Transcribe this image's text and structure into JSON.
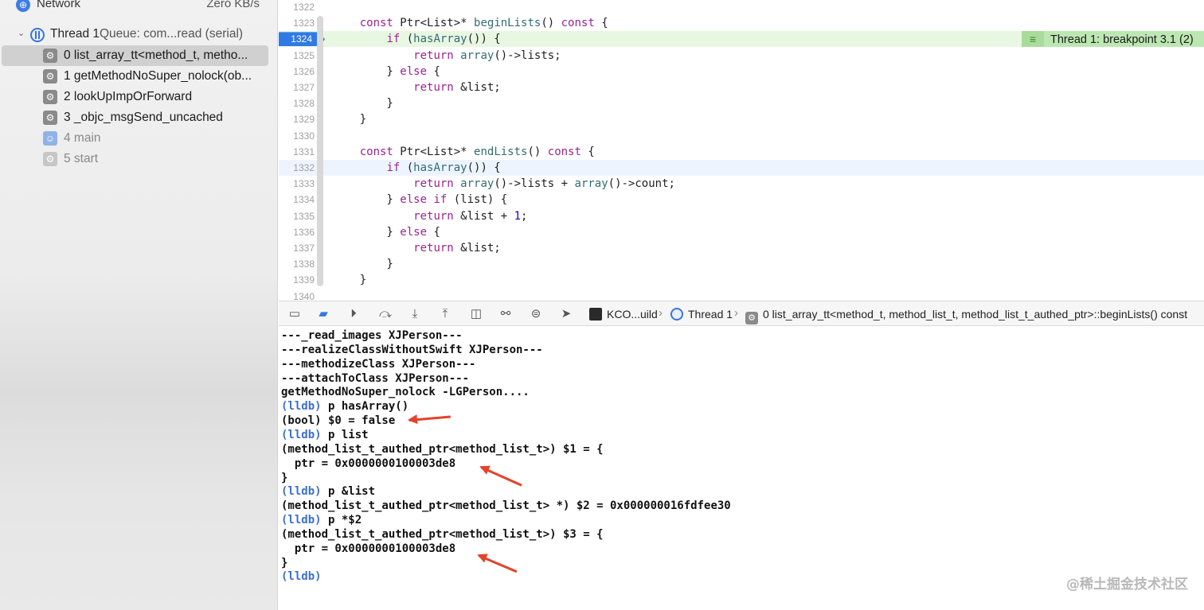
{
  "sidebar": {
    "network": {
      "icon": "network-globe-icon",
      "label": "Network",
      "value": "Zero KB/s"
    },
    "thread": {
      "name": "Thread 1",
      "queue": "Queue: com...read (serial)"
    },
    "frames": [
      {
        "label": "0 list_array_tt<method_t, metho...",
        "icon": "gear-icon",
        "selected": true
      },
      {
        "label": "1 getMethodNoSuper_nolock(ob...",
        "icon": "gear-icon"
      },
      {
        "label": "2 lookUpImpOrForward",
        "icon": "gear-icon"
      },
      {
        "label": "3 _objc_msgSend_uncached",
        "icon": "gear-icon"
      },
      {
        "label": "4 main",
        "icon": "user-icon"
      },
      {
        "label": "5 start",
        "icon": "gear-icon"
      }
    ]
  },
  "editor": {
    "lines": [
      {
        "num": "1322",
        "text": ""
      },
      {
        "num": "1323",
        "text": "    const Ptr<List>* beginLists() const {"
      },
      {
        "num": "1324",
        "text": "        if (hasArray()) {"
      },
      {
        "num": "1325",
        "text": "            return array()->lists;"
      },
      {
        "num": "1326",
        "text": "        } else {"
      },
      {
        "num": "1327",
        "text": "            return &list;"
      },
      {
        "num": "1328",
        "text": "        }"
      },
      {
        "num": "1329",
        "text": "    }"
      },
      {
        "num": "1330",
        "text": ""
      },
      {
        "num": "1331",
        "text": "    const Ptr<List>* endLists() const {"
      },
      {
        "num": "1332",
        "text": "        if (hasArray()) {"
      },
      {
        "num": "1333",
        "text": "            return array()->lists + array()->count;"
      },
      {
        "num": "1334",
        "text": "        } else if (list) {"
      },
      {
        "num": "1335",
        "text": "            return &list + 1;"
      },
      {
        "num": "1336",
        "text": "        } else {"
      },
      {
        "num": "1337",
        "text": "            return &list;"
      },
      {
        "num": "1338",
        "text": "        }"
      },
      {
        "num": "1339",
        "text": "    }"
      },
      {
        "num": "1340",
        "text": ""
      }
    ],
    "breakpoint_line": "1324",
    "breakpoint_banner": "Thread 1: breakpoint 3.1 (2)"
  },
  "debugbar": {
    "buttons": [
      "hide-console-icon",
      "breakpoints-toggle-icon",
      "continue-icon",
      "step-over-icon",
      "step-into-icon",
      "step-out-icon",
      "view-hierarchy-icon",
      "memory-graph-icon",
      "environment-overrides-icon",
      "simulate-location-icon"
    ],
    "breadcrumbs": [
      "KCO...uild",
      "Thread 1",
      "0 list_array_tt<method_t, method_list_t, method_list_t_authed_ptr>::beginLists() const"
    ]
  },
  "console": {
    "lines": [
      {
        "prompt": "",
        "text": "---_read_images XJPerson---"
      },
      {
        "prompt": "",
        "text": "---realizeClassWithoutSwift XJPerson---"
      },
      {
        "prompt": "",
        "text": "---methodizeClass XJPerson---"
      },
      {
        "prompt": "",
        "text": "---attachToClass XJPerson---"
      },
      {
        "prompt": "",
        "text": "getMethodNoSuper_nolock -LGPerson...."
      },
      {
        "prompt": "(lldb)",
        "text": " p hasArray()"
      },
      {
        "prompt": "",
        "text": "(bool) $0 = false"
      },
      {
        "prompt": "(lldb)",
        "text": " p list"
      },
      {
        "prompt": "",
        "text": "(method_list_t_authed_ptr<method_list_t>) $1 = {"
      },
      {
        "prompt": "",
        "text": "  ptr = 0x0000000100003de8"
      },
      {
        "prompt": "",
        "text": "}"
      },
      {
        "prompt": "(lldb)",
        "text": " p &list"
      },
      {
        "prompt": "",
        "text": "(method_list_t_authed_ptr<method_list_t> *) $2 = 0x000000016fdfee30"
      },
      {
        "prompt": "(lldb)",
        "text": " p *$2"
      },
      {
        "prompt": "",
        "text": "(method_list_t_authed_ptr<method_list_t>) $3 = {"
      },
      {
        "prompt": "",
        "text": "  ptr = 0x0000000100003de8"
      },
      {
        "prompt": "",
        "text": "}"
      },
      {
        "prompt": "(lldb)",
        "text": ""
      }
    ],
    "watermark": "@稀土掘金技术社区",
    "annotation_color": "#e4422a"
  }
}
